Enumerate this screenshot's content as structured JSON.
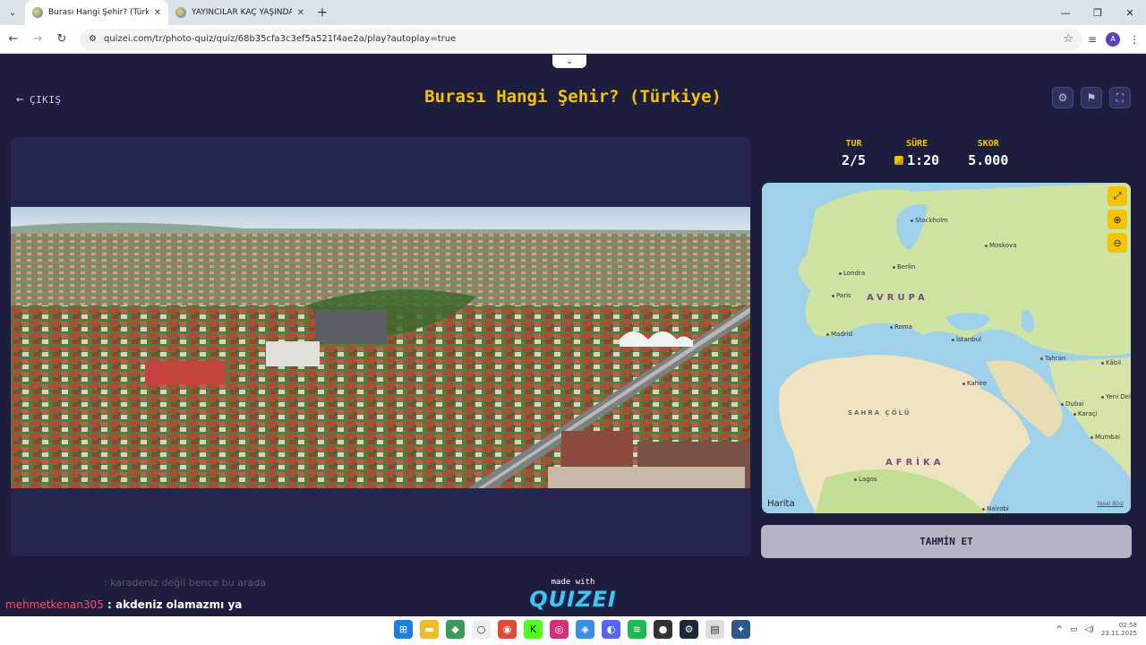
{
  "browser": {
    "tabs": [
      {
        "title": "Burası Hangi Şehir? (Türkiye) - Q",
        "active": true
      },
      {
        "title": "YAYINCILAR KAÇ YAŞINDA ? - P",
        "active": false
      }
    ],
    "url": "quizei.com/tr/photo-quiz/quiz/68b35cfa3c3ef5a521f4ae2a/play?autoplay=true",
    "avatar": "A"
  },
  "header": {
    "exit_label": "ÇIKIŞ",
    "title": "Burası Hangi Şehir? (Türkiye)"
  },
  "stats": {
    "round_label": "TUR",
    "round_value": "2/5",
    "time_label": "SÜRE",
    "time_value": "1:20",
    "score_label": "SKOR",
    "score_value": "5.000"
  },
  "map": {
    "regions": {
      "europe": "AVRUPA",
      "africa": "AFRİKA",
      "sahara": "SAHRA ÇÖLÜ"
    },
    "cities": [
      "Stockholm",
      "Moskova",
      "Londra",
      "Berlin",
      "Paris",
      "Madrid",
      "Roma",
      "İstanbul",
      "Tahran",
      "Kâbil",
      "Kahire",
      "Yeni Del",
      "Dubai",
      "Karaçi",
      "Mumbai",
      "Lagos",
      "Nairobi"
    ],
    "attribution": "Harita",
    "legal": "Yasal Bilgi"
  },
  "guess_button": "TAHMİN ET",
  "branding": {
    "made_with": "made with",
    "logo": "QUIZEI"
  },
  "chat": [
    {
      "user": "",
      "message": ": karadeniz değil bence bu arada"
    },
    {
      "user": "mehmetkenan305",
      "message": ": akdeniz olamazmı ya"
    }
  ],
  "taskbar": {
    "clock_time": "02:58",
    "clock_date": "23.11.2025"
  }
}
